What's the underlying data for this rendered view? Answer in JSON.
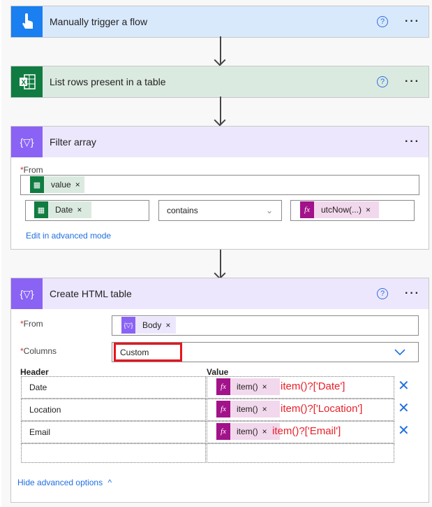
{
  "steps": [
    {
      "title": "Manually trigger a flow",
      "icon": "hand-pointer-icon",
      "color": "#1a7ff0",
      "bg": "#d9e9fc"
    },
    {
      "title": "List rows present in a table",
      "icon": "excel-icon",
      "color": "#107c41",
      "bg": "#dbeae0"
    },
    {
      "title": "Filter array",
      "icon": "filter-array-icon",
      "color": "#8a63f5",
      "bg": "#ede7fd"
    },
    {
      "title": "Create HTML table",
      "icon": "filter-array-icon",
      "color": "#8a63f5",
      "bg": "#ede7fd"
    }
  ],
  "filter": {
    "from_label": "From",
    "from_token": "value",
    "left_token": "Date",
    "operator": "contains",
    "right_token": "utcNow(...)",
    "advanced_link": "Edit in advanced mode"
  },
  "html_table": {
    "from_label": "From",
    "from_token": "Body",
    "columns_label": "Columns",
    "columns_value": "Custom",
    "header_col": "Header",
    "value_col": "Value",
    "rows": [
      {
        "header": "Date",
        "token": "item()",
        "annotation": "item()?['Date']"
      },
      {
        "header": "Location",
        "token": "item()",
        "annotation": "item()?['Location']"
      },
      {
        "header": "Email",
        "token": "item()",
        "annotation": "item()?['Email']"
      }
    ],
    "hide_link": "Hide advanced options"
  },
  "symbols": {
    "help": "?",
    "more": "···",
    "remove": "×",
    "required": "*",
    "fx": "fx",
    "delete": "✕",
    "chevron_down": "⌄",
    "chevron_up": "^"
  }
}
